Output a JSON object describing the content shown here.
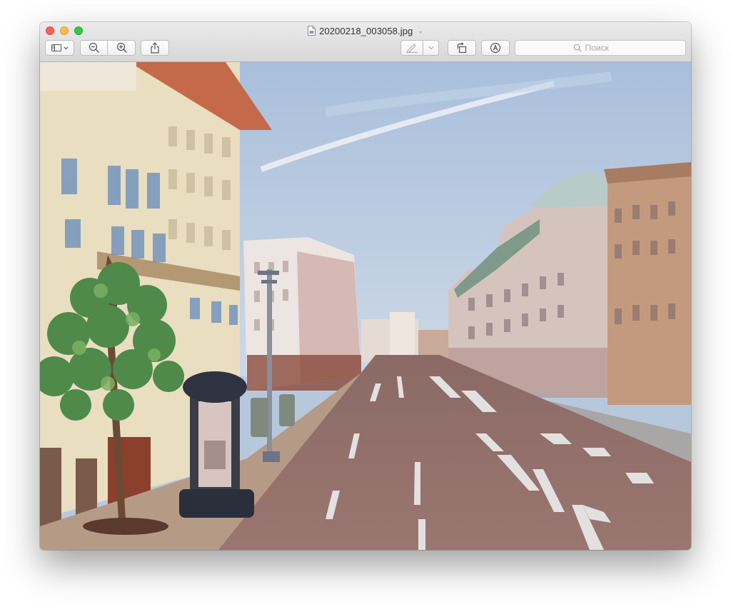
{
  "window": {
    "title": "20200218_003058.jpg"
  },
  "toolbar": {
    "sidebar_button": "sidebar-icon",
    "zoom_out_button": "zoom-out-icon",
    "zoom_in_button": "zoom-in-icon",
    "share_button": "share-icon",
    "markup_button": "pen-icon",
    "rotate_button": "rotate-left-icon",
    "annotate_button": "markup-icon"
  },
  "search": {
    "placeholder": "Поиск",
    "value": ""
  },
  "colors": {
    "close": "#fc605c",
    "minimize": "#fdbc40",
    "zoom": "#34c84a"
  }
}
